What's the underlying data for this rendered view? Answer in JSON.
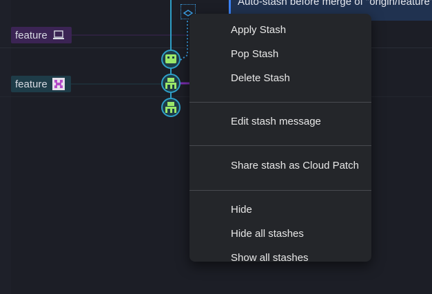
{
  "graph": {
    "branches": [
      {
        "label": "feature",
        "icon": "laptop-icon",
        "color": "#3b2454"
      },
      {
        "label": "feature",
        "icon": "avatar-icon",
        "color": "#1e3c48"
      }
    ],
    "stash_row_text": "Auto-stash before merge of \"origin/feature\"",
    "colors": {
      "lane": "#2ea0c8",
      "node_fill": "#1e3c48",
      "node_icon": "#9be86a",
      "branch_line_purple": "#7b2fb3"
    }
  },
  "context_menu": {
    "groups": [
      [
        {
          "label": "Apply Stash"
        },
        {
          "label": "Pop Stash"
        },
        {
          "label": "Delete Stash"
        }
      ],
      [
        {
          "label": "Edit stash message"
        }
      ],
      [
        {
          "label": "Share stash as Cloud Patch"
        }
      ],
      [
        {
          "label": "Hide"
        },
        {
          "label": "Hide all stashes"
        },
        {
          "label": "Show all stashes"
        }
      ]
    ]
  }
}
